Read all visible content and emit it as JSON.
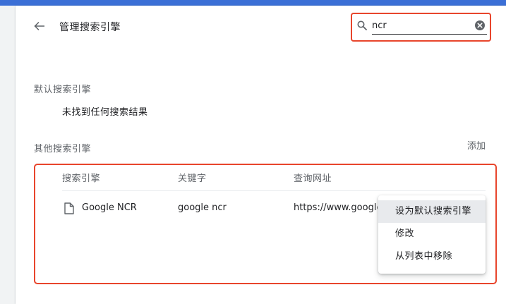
{
  "header": {
    "title": "管理搜索引擎",
    "back_icon": "arrow-back-icon"
  },
  "search": {
    "value": "ncr",
    "placeholder": "",
    "icon": "search-icon",
    "clear_icon": "clear-circle-icon",
    "highlight_color": "#e8452c"
  },
  "default_section": {
    "title": "默认搜索引擎",
    "empty_message": "未找到任何搜索结果"
  },
  "other_section": {
    "title": "其他搜索引擎",
    "add_label": "添加",
    "columns": [
      "搜索引擎",
      "关键字",
      "查询网址"
    ],
    "rows": [
      {
        "icon": "document-icon",
        "name": "Google NCR",
        "keyword": "google ncr",
        "url": "https://www.google.com/"
      }
    ]
  },
  "context_menu": {
    "items": [
      "设为默认搜索引擎",
      "修改",
      "从列表中移除"
    ],
    "active_index": 0
  },
  "colors": {
    "top_bar": "#3b6fd6",
    "highlight_border": "#e8452c",
    "background": "#f1f3f4"
  }
}
